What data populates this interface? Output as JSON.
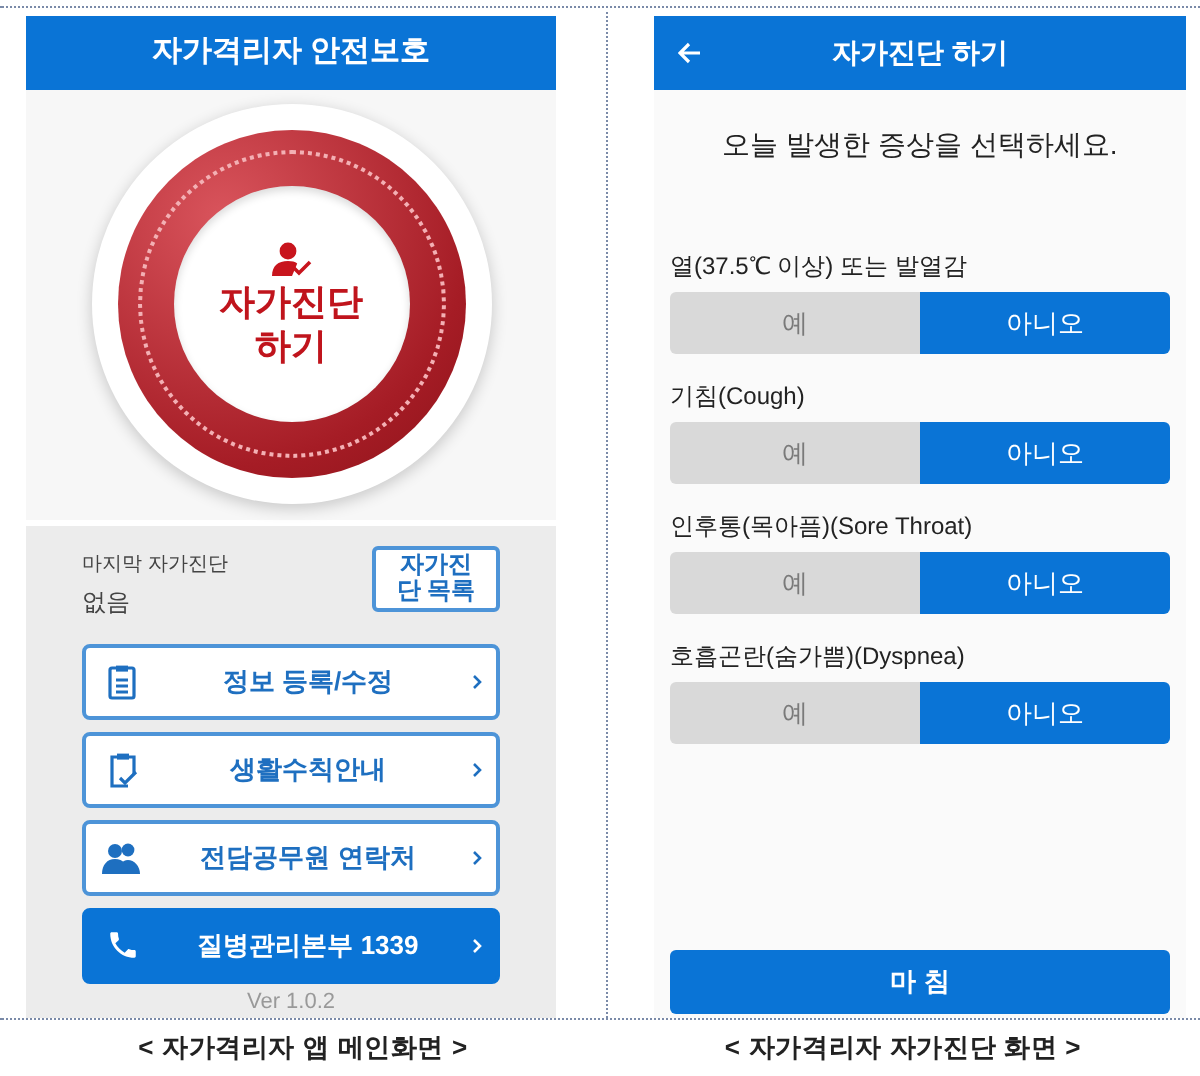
{
  "main_screen": {
    "title": "자가격리자 안전보호",
    "self_check_button": "자가진단 하기",
    "last_check": {
      "label": "마지막 자가진단",
      "value": "없음"
    },
    "history_button": "자가진단 목록",
    "menu": [
      {
        "kind": "clipboard",
        "label": "정보 등록/수정",
        "filled": false
      },
      {
        "kind": "clipboard-check",
        "label": "생활수칙안내",
        "filled": false
      },
      {
        "kind": "people",
        "label": "전담공무원 연락처",
        "filled": false
      },
      {
        "kind": "phone",
        "label": "질병관리본부 1339",
        "filled": true
      }
    ],
    "version": "Ver 1.0.2",
    "caption": "< 자가격리자 앱 메인화면 >"
  },
  "check_screen": {
    "title": "자가진단 하기",
    "prompt": "오늘 발생한 증상을 선택하세요.",
    "questions": [
      {
        "label": "열(37.5℃ 이상) 또는 발열감",
        "options": [
          {
            "label": "예",
            "selected": false
          },
          {
            "label": "아니오",
            "selected": true
          }
        ]
      },
      {
        "label": "기침(Cough)",
        "options": [
          {
            "label": "예",
            "selected": false
          },
          {
            "label": "아니오",
            "selected": true
          }
        ]
      },
      {
        "label": "인후통(목아픔)(Sore Throat)",
        "options": [
          {
            "label": "예",
            "selected": false
          },
          {
            "label": "아니오",
            "selected": true
          }
        ]
      },
      {
        "label": "호흡곤란(숨가쁨)(Dyspnea)",
        "options": [
          {
            "label": "예",
            "selected": false
          },
          {
            "label": "아니오",
            "selected": true
          }
        ]
      }
    ],
    "finish_button": "마 침",
    "caption": "< 자가격리자 자가진단 화면 >"
  }
}
